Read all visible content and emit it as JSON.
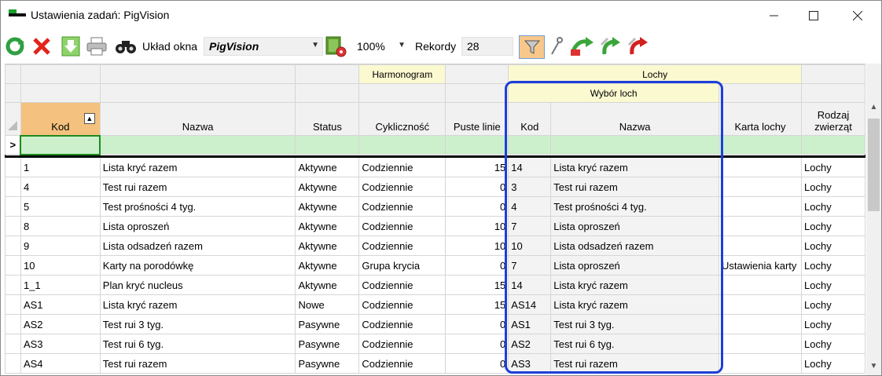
{
  "window": {
    "title": "Ustawienia zadań: PigVision"
  },
  "toolbar": {
    "layout_label": "Układ okna",
    "layout_value": "PigVision",
    "zoom_value": "100%",
    "records_label": "Rekordy",
    "records_value": "28"
  },
  "grid": {
    "groups": {
      "harmonogram": "Harmonogram",
      "lochy": "Lochy",
      "wybor_loch": "Wybór loch"
    },
    "columns": [
      "Kod",
      "Nazwa",
      "Status",
      "Cykliczność",
      "Puste linie",
      "Kod",
      "Nazwa",
      "Karta lochy",
      "Rodzaj zwierząt"
    ],
    "new_row_marker": ">",
    "rows": [
      [
        "1",
        "Lista kryć razem",
        "Aktywne",
        "Codziennie",
        "15",
        "14",
        "Lista kryć razem",
        "",
        "Lochy"
      ],
      [
        "4",
        "Test rui razem",
        "Aktywne",
        "Codziennie",
        "0",
        "3",
        "Test rui razem",
        "",
        "Lochy"
      ],
      [
        "5",
        "Test prośności 4 tyg.",
        "Aktywne",
        "Codziennie",
        "0",
        "4",
        "Test prośności 4 tyg.",
        "",
        "Lochy"
      ],
      [
        "8",
        "Lista oproszeń",
        "Aktywne",
        "Codziennie",
        "10",
        "7",
        "Lista oproszeń",
        "",
        "Lochy"
      ],
      [
        "9",
        "Lista odsadzeń razem",
        "Aktywne",
        "Codziennie",
        "10",
        "10",
        "Lista odsadzeń razem",
        "",
        "Lochy"
      ],
      [
        "10",
        "Karty na porodówkę",
        "Aktywne",
        "Grupa krycia",
        "0",
        "7",
        "Lista oproszeń",
        "Ustawienia karty",
        "Lochy"
      ],
      [
        "1_1",
        "Plan kryć nucleus",
        "Aktywne",
        "Codziennie",
        "15",
        "14",
        "Lista kryć razem",
        "",
        "Lochy"
      ],
      [
        "AS1",
        "Lista kryć razem",
        "Nowe",
        "Codziennie",
        "15",
        "AS14",
        "Lista kryć razem",
        "",
        "Lochy"
      ],
      [
        "AS2",
        "Test rui 3 tyg.",
        "Pasywne",
        "Codziennie",
        "0",
        "AS1",
        "Test rui 3 tyg.",
        "",
        "Lochy"
      ],
      [
        "AS3",
        "Test rui 6 tyg.",
        "Pasywne",
        "Codziennie",
        "0",
        "AS2",
        "Test rui 6 tyg.",
        "",
        "Lochy"
      ],
      [
        "AS4",
        "Test rui razem",
        "Pasywne",
        "Codziennie",
        "0",
        "AS3",
        "Test rui razem",
        "",
        "Lochy"
      ]
    ]
  },
  "icons": {
    "refresh": "refresh-icon",
    "delete": "delete-icon",
    "export": "export-icon",
    "print": "print-icon",
    "binoculars": "binoculars-icon",
    "settings": "settings-book-icon",
    "filter": "filter-icon",
    "wrench": "wrench-icon",
    "move_right": "move-right-icon",
    "move_left": "move-left-icon",
    "move_back": "move-back-icon"
  }
}
